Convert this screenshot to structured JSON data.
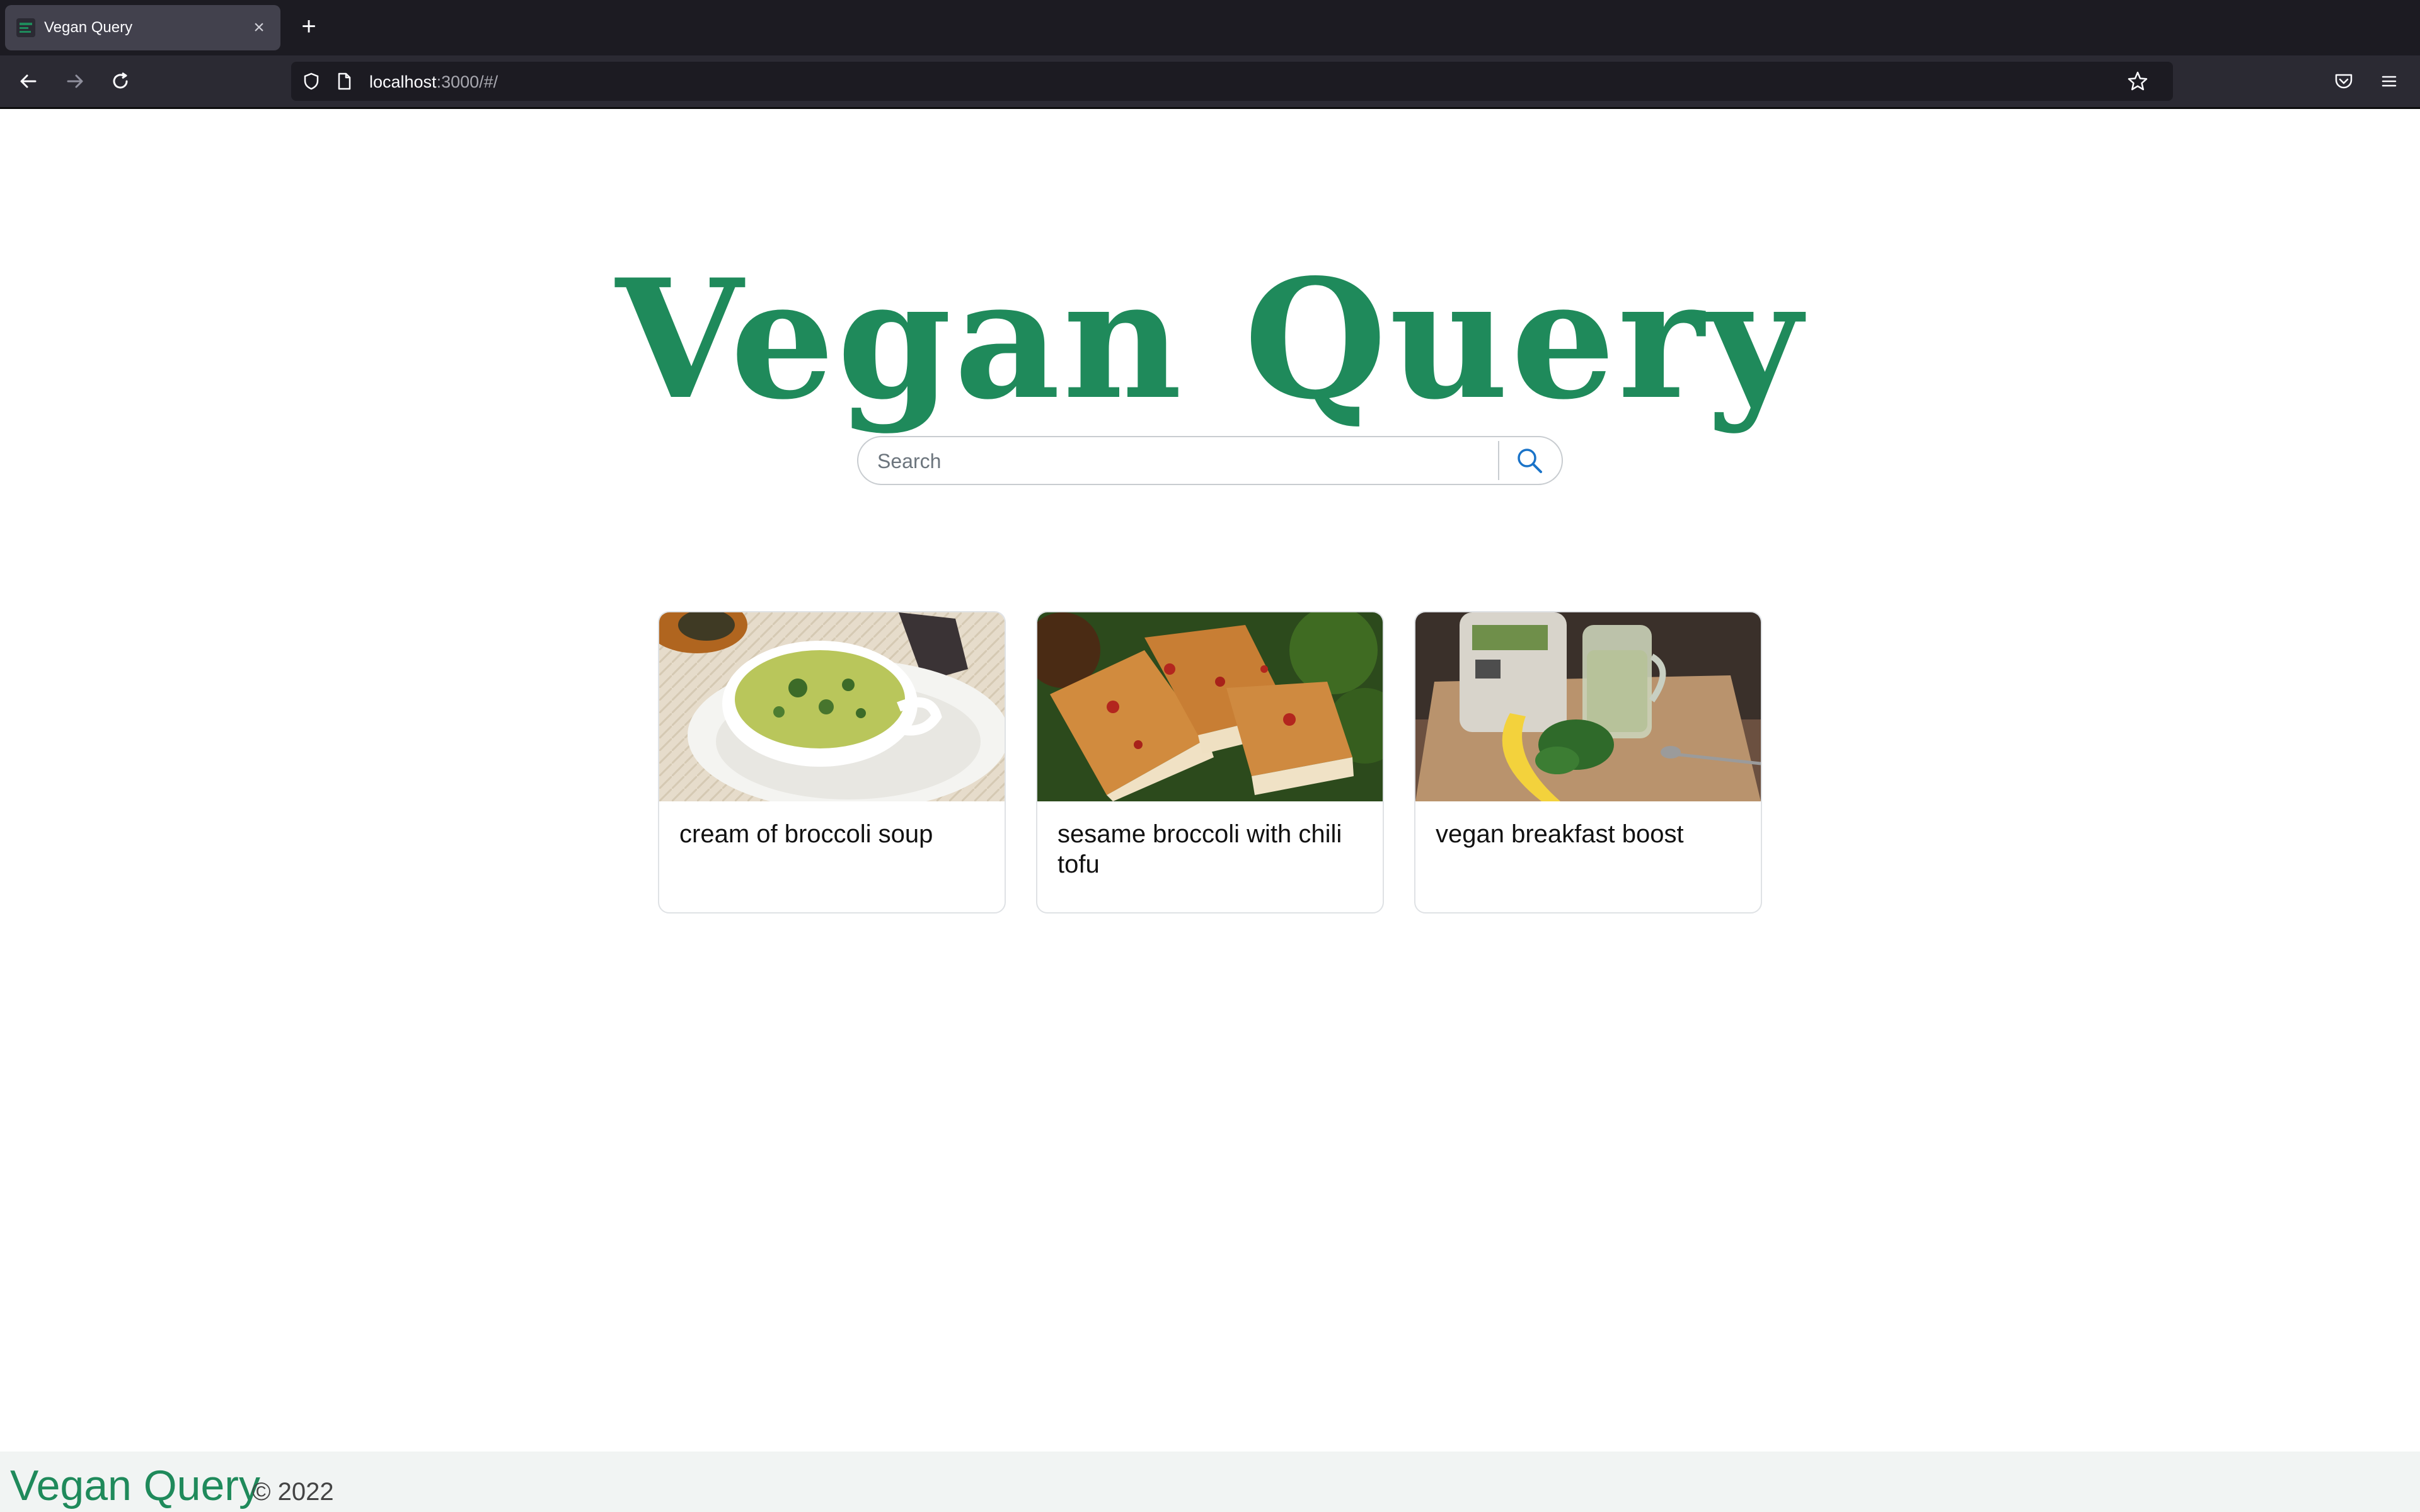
{
  "browser": {
    "tab_title": "Vegan Query",
    "new_tab_label": "+",
    "url_host": "localhost",
    "url_path": ":3000/#/"
  },
  "page": {
    "brand_title": "Vegan Query",
    "search": {
      "placeholder": "Search"
    },
    "recipes": [
      {
        "title": "cream of broccoli soup"
      },
      {
        "title": "sesame broccoli with chili tofu"
      },
      {
        "title": "vegan breakfast boost"
      }
    ]
  },
  "footer": {
    "brand": "Vegan Query",
    "copyright": "© 2022"
  },
  "colors": {
    "brand_green": "#1f8a5b",
    "search_icon": "#1a73c8",
    "chrome_dark": "#1c1b22"
  },
  "icons": [
    "back-arrow-icon",
    "forward-arrow-icon",
    "reload-icon",
    "shield-icon",
    "page-icon",
    "bookmark-star-icon",
    "pocket-icon",
    "menu-icon",
    "search-icon",
    "close-icon"
  ]
}
